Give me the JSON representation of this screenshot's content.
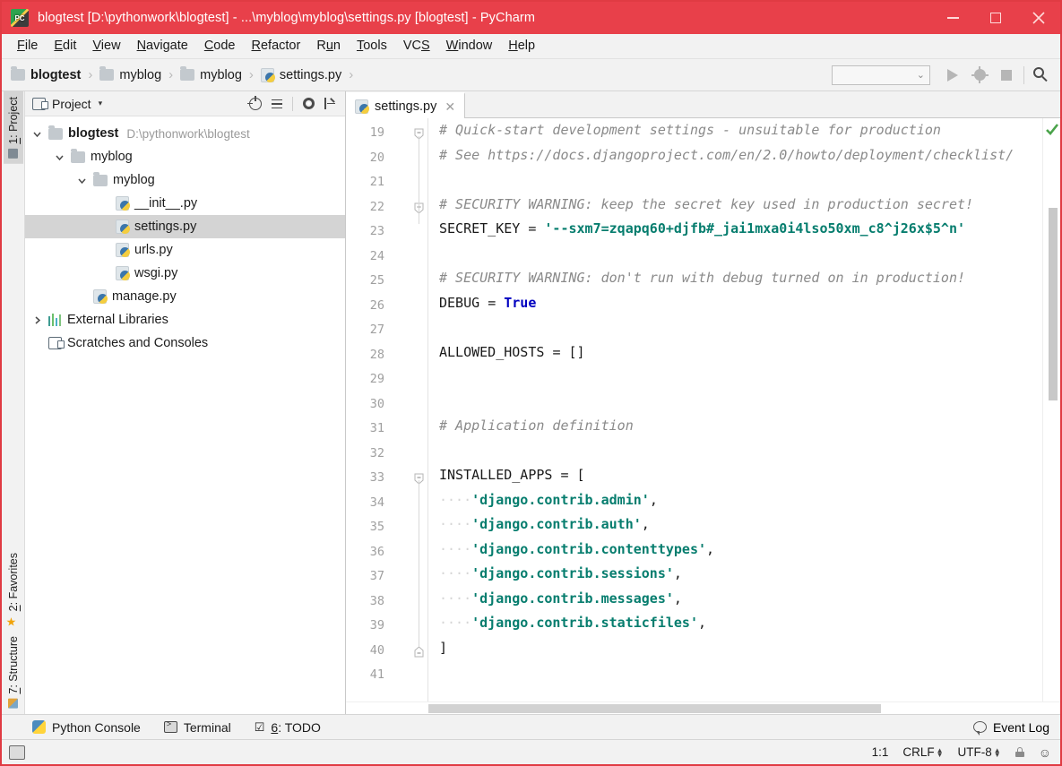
{
  "window": {
    "title": "blogtest [D:\\pythonwork\\blogtest] - ...\\myblog\\myblog\\settings.py [blogtest] - PyCharm",
    "app_icon": "pycharm-icon",
    "minimize_label": "–",
    "maximize_label": "□",
    "close_label": "✕",
    "titlebar_color": "#E8404A"
  },
  "menu": {
    "items": [
      {
        "label": "File",
        "mnemonic": "F"
      },
      {
        "label": "Edit",
        "mnemonic": "E"
      },
      {
        "label": "View",
        "mnemonic": "V"
      },
      {
        "label": "Navigate",
        "mnemonic": "N"
      },
      {
        "label": "Code",
        "mnemonic": "C"
      },
      {
        "label": "Refactor",
        "mnemonic": "R"
      },
      {
        "label": "Run",
        "mnemonic": "u"
      },
      {
        "label": "Tools",
        "mnemonic": "T"
      },
      {
        "label": "VCS",
        "mnemonic": "S"
      },
      {
        "label": "Window",
        "mnemonic": "W"
      },
      {
        "label": "Help",
        "mnemonic": "H"
      }
    ]
  },
  "breadcrumb": {
    "separator": "›",
    "items": [
      {
        "label": "blogtest",
        "icon": "folder-icon"
      },
      {
        "label": "myblog",
        "icon": "folder-icon"
      },
      {
        "label": "myblog",
        "icon": "folder-icon"
      },
      {
        "label": "settings.py",
        "icon": "python-file-icon"
      }
    ]
  },
  "toolbar": {
    "run_config_value": "",
    "run_config_caret": "⌄",
    "run_label": "run-button",
    "debug_label": "debug-button",
    "stop_label": "stop-button",
    "search_label": "search-everywhere"
  },
  "left_strip": {
    "tabs": [
      {
        "label": "1: Project",
        "mnemonic": "1",
        "icon": "project-icon",
        "active": true
      },
      {
        "label": "2: Favorites",
        "mnemonic": "2",
        "icon": "star-icon",
        "active": false
      },
      {
        "label": "7: Structure",
        "mnemonic": "7",
        "icon": "structure-icon",
        "active": false
      }
    ]
  },
  "project_panel": {
    "title": "Project",
    "caret": "▾",
    "tools": [
      {
        "name": "locate-icon"
      },
      {
        "name": "collapse-all-icon"
      },
      {
        "name": "settings-gear-icon"
      },
      {
        "name": "hide-icon"
      }
    ],
    "tree": [
      {
        "label": "blogtest",
        "path": "D:\\pythonwork\\blogtest",
        "icon": "folder-icon",
        "indent": 0,
        "twisty": "down",
        "bold": true,
        "selected": false
      },
      {
        "label": "myblog",
        "path": "",
        "icon": "folder-icon",
        "indent": 1,
        "twisty": "down",
        "bold": false,
        "selected": false
      },
      {
        "label": "myblog",
        "path": "",
        "icon": "folder-icon",
        "indent": 2,
        "twisty": "down",
        "bold": false,
        "selected": false
      },
      {
        "label": "__init__.py",
        "path": "",
        "icon": "python-file-icon",
        "indent": 3,
        "twisty": "none",
        "bold": false,
        "selected": false
      },
      {
        "label": "settings.py",
        "path": "",
        "icon": "python-file-icon",
        "indent": 3,
        "twisty": "none",
        "bold": false,
        "selected": true
      },
      {
        "label": "urls.py",
        "path": "",
        "icon": "python-file-icon",
        "indent": 3,
        "twisty": "none",
        "bold": false,
        "selected": false
      },
      {
        "label": "wsgi.py",
        "path": "",
        "icon": "python-file-icon",
        "indent": 3,
        "twisty": "none",
        "bold": false,
        "selected": false
      },
      {
        "label": "manage.py",
        "path": "",
        "icon": "python-file-icon",
        "indent": 2,
        "twisty": "none",
        "bold": false,
        "selected": false
      },
      {
        "label": "External Libraries",
        "path": "",
        "icon": "library-icon",
        "indent": 0,
        "twisty": "right",
        "bold": false,
        "selected": false
      },
      {
        "label": "Scratches and Consoles",
        "path": "",
        "icon": "scratches-icon",
        "indent": 0,
        "twisty": "none",
        "bold": false,
        "selected": false
      }
    ]
  },
  "editor": {
    "tabs": [
      {
        "label": "settings.py",
        "icon": "python-file-icon",
        "close": "✕",
        "active": true
      }
    ],
    "inspection_status": "ok-check-icon",
    "first_line": 19,
    "lines": [
      {
        "n": 19,
        "fold": "start",
        "tokens": [
          {
            "t": "comment",
            "v": "# Quick-start development settings - unsuitable for production"
          }
        ]
      },
      {
        "n": 20,
        "fold": "none",
        "tokens": [
          {
            "t": "comment",
            "v": "# See https://docs.djangoproject.com/en/2.0/howto/deployment/checklist/"
          }
        ]
      },
      {
        "n": 21,
        "fold": "none",
        "tokens": []
      },
      {
        "n": 22,
        "fold": "start",
        "tokens": [
          {
            "t": "comment",
            "v": "# SECURITY WARNING: keep the secret key used in production secret!"
          }
        ]
      },
      {
        "n": 23,
        "fold": "none",
        "tokens": [
          {
            "t": "id",
            "v": "SECRET_KEY "
          },
          {
            "t": "punct",
            "v": "= "
          },
          {
            "t": "str",
            "v": "'--sxm7=zqapq60+djfb#_jai1mxa0i4lso50xm_c8^j26x$5^n'"
          }
        ]
      },
      {
        "n": 24,
        "fold": "none",
        "tokens": []
      },
      {
        "n": 25,
        "fold": "none",
        "tokens": [
          {
            "t": "comment",
            "v": "# SECURITY WARNING: don't run with debug turned on in production!"
          }
        ]
      },
      {
        "n": 26,
        "fold": "none",
        "tokens": [
          {
            "t": "id",
            "v": "DEBUG "
          },
          {
            "t": "punct",
            "v": "= "
          },
          {
            "t": "kw",
            "v": "True"
          }
        ]
      },
      {
        "n": 27,
        "fold": "none",
        "tokens": []
      },
      {
        "n": 28,
        "fold": "none",
        "tokens": [
          {
            "t": "id",
            "v": "ALLOWED_HOSTS "
          },
          {
            "t": "punct",
            "v": "= []"
          }
        ]
      },
      {
        "n": 29,
        "fold": "none",
        "tokens": []
      },
      {
        "n": 30,
        "fold": "none",
        "tokens": []
      },
      {
        "n": 31,
        "fold": "none",
        "tokens": [
          {
            "t": "comment",
            "v": "# Application definition"
          }
        ]
      },
      {
        "n": 32,
        "fold": "none",
        "tokens": []
      },
      {
        "n": 33,
        "fold": "start",
        "tokens": [
          {
            "t": "id",
            "v": "INSTALLED_APPS "
          },
          {
            "t": "punct",
            "v": "= ["
          }
        ]
      },
      {
        "n": 34,
        "fold": "none",
        "tokens": [
          {
            "t": "indent",
            "v": "    "
          },
          {
            "t": "str",
            "v": "'django.contrib.admin'"
          },
          {
            "t": "punct",
            "v": ","
          }
        ]
      },
      {
        "n": 35,
        "fold": "none",
        "tokens": [
          {
            "t": "indent",
            "v": "    "
          },
          {
            "t": "str",
            "v": "'django.contrib.auth'"
          },
          {
            "t": "punct",
            "v": ","
          }
        ]
      },
      {
        "n": 36,
        "fold": "none",
        "tokens": [
          {
            "t": "indent",
            "v": "    "
          },
          {
            "t": "str",
            "v": "'django.contrib.contenttypes'"
          },
          {
            "t": "punct",
            "v": ","
          }
        ]
      },
      {
        "n": 37,
        "fold": "none",
        "tokens": [
          {
            "t": "indent",
            "v": "    "
          },
          {
            "t": "str",
            "v": "'django.contrib.sessions'"
          },
          {
            "t": "punct",
            "v": ","
          }
        ]
      },
      {
        "n": 38,
        "fold": "none",
        "tokens": [
          {
            "t": "indent",
            "v": "    "
          },
          {
            "t": "str",
            "v": "'django.contrib.messages'"
          },
          {
            "t": "punct",
            "v": ","
          }
        ]
      },
      {
        "n": 39,
        "fold": "none",
        "tokens": [
          {
            "t": "indent",
            "v": "    "
          },
          {
            "t": "str",
            "v": "'django.contrib.staticfiles'"
          },
          {
            "t": "punct",
            "v": ","
          }
        ]
      },
      {
        "n": 40,
        "fold": "end",
        "tokens": [
          {
            "t": "punct",
            "v": "]"
          }
        ]
      },
      {
        "n": 41,
        "fold": "none",
        "tokens": []
      }
    ]
  },
  "tool_window_bar": {
    "items": [
      {
        "label": "Python Console",
        "icon": "python-icon",
        "mnemonic": ""
      },
      {
        "label": "Terminal",
        "icon": "terminal-icon",
        "mnemonic": ""
      },
      {
        "label": "6: TODO",
        "icon": "todo-icon",
        "mnemonic": "6"
      }
    ],
    "event_log": {
      "label": "Event Log",
      "icon": "bubble-icon"
    }
  },
  "status_bar": {
    "caret_position": "1:1",
    "line_separator": "CRLF",
    "encoding": "UTF-8",
    "lock": "lock-icon",
    "inspection": "hector-icon"
  }
}
